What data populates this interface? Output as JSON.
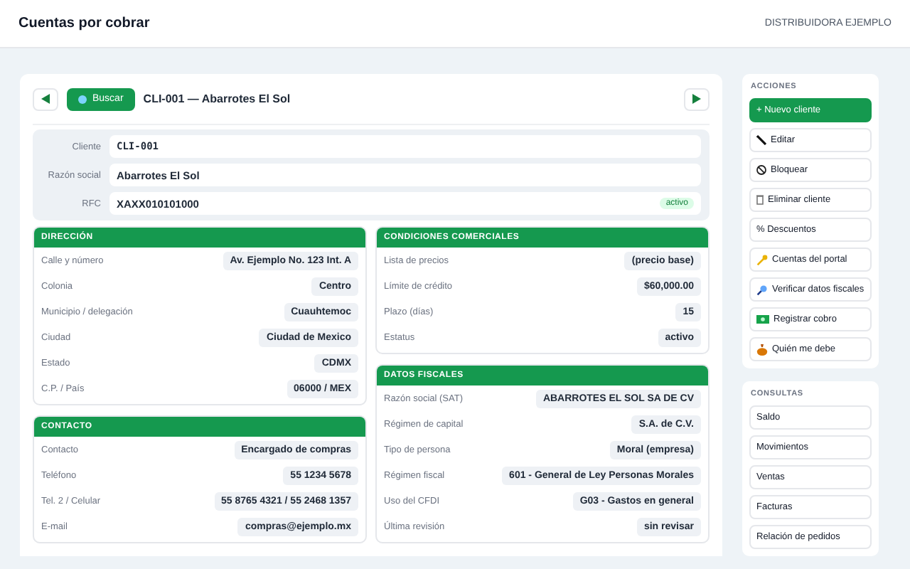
{
  "header": {
    "title": "Cuentas por cobrar",
    "company": "DISTRIBUIDORA EJEMPLO"
  },
  "nav": {
    "search_label": "Buscar",
    "record": "CLI-001 — Abarrotes El Sol"
  },
  "summary": [
    {
      "label": "Cliente",
      "value": "CLI-001",
      "kind": "mono"
    },
    {
      "label": "Razón social",
      "value": "Abarrotes El Sol",
      "kind": "text"
    },
    {
      "label": "RFC",
      "value": "XAXX010101000",
      "kind": "text",
      "badge": "activo"
    }
  ],
  "columns": [
    [
      {
        "title": "DIRECCIÓN",
        "rows": [
          {
            "label": "Calle y número",
            "value": "Av. Ejemplo No. 123 Int. A"
          },
          {
            "label": "Colonia",
            "value": "Centro"
          },
          {
            "label": "Municipio / delegación",
            "value": "Cuauhtemoc"
          },
          {
            "label": "Ciudad",
            "value": "Ciudad de Mexico"
          },
          {
            "label": "Estado",
            "value": "CDMX"
          },
          {
            "label": "C.P. / País",
            "value": "06000 / MEX"
          }
        ]
      },
      {
        "title": "CONTACTO",
        "rows": [
          {
            "label": "Contacto",
            "value": "Encargado de compras"
          },
          {
            "label": "Teléfono",
            "value": "55 1234 5678"
          },
          {
            "label": "Tel. 2 / Celular",
            "value": "55 8765 4321 / 55 2468 1357"
          },
          {
            "label": "E-mail",
            "value": "compras@ejemplo.mx"
          }
        ]
      }
    ],
    [
      {
        "title": "CONDICIONES COMERCIALES",
        "rows": [
          {
            "label": "Lista de precios",
            "value": "(precio base)"
          },
          {
            "label": "Límite de crédito",
            "value": "$60,000.00"
          },
          {
            "label": "Plazo (días)",
            "value": "15"
          },
          {
            "label": "Estatus",
            "value": "activo"
          }
        ]
      },
      {
        "title": "DATOS FISCALES",
        "rows": [
          {
            "label": "Razón social (SAT)",
            "value": "ABARROTES EL SOL SA DE CV"
          },
          {
            "label": "Régimen de capital",
            "value": "S.A. de C.V."
          },
          {
            "label": "Tipo de persona",
            "value": "Moral (empresa)"
          },
          {
            "label": "Régimen fiscal",
            "value": "601 - General de Ley Personas Morales"
          },
          {
            "label": "Uso del CFDI",
            "value": "G03 - Gastos en general"
          },
          {
            "label": "Última revisión",
            "value": "sin revisar"
          }
        ]
      }
    ]
  ],
  "sidebar": [
    {
      "title": "ACCIONES",
      "items": [
        {
          "label": "+ Nuevo cliente",
          "kind": "primary"
        },
        {
          "label": "Editar",
          "kind": "pencil"
        },
        {
          "label": "Bloquear",
          "kind": "block"
        },
        {
          "label": "Eliminar cliente",
          "kind": "trash"
        },
        {
          "label": "% Descuentos",
          "kind": "plain"
        },
        {
          "label": "Cuentas del portal",
          "kind": "key"
        },
        {
          "label": "Verificar datos fiscales",
          "kind": "magnifier"
        },
        {
          "label": "Registrar cobro",
          "kind": "money"
        },
        {
          "label": "Quién me debe",
          "kind": "bag"
        }
      ]
    },
    {
      "title": "CONSULTAS",
      "items": [
        {
          "label": "Saldo",
          "kind": "plain"
        },
        {
          "label": "Movimientos",
          "kind": "plain"
        },
        {
          "label": "Ventas",
          "kind": "plain"
        },
        {
          "label": "Facturas",
          "kind": "plain"
        },
        {
          "label": "Relación de pedidos",
          "kind": "plain"
        }
      ]
    }
  ]
}
